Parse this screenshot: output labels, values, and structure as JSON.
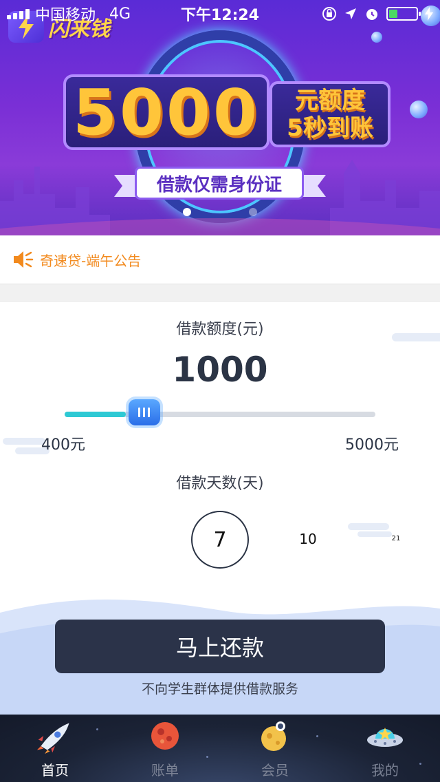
{
  "status_bar": {
    "carrier": "中国移动",
    "network": "4G",
    "time": "下午12:24",
    "battery_level": 0.25
  },
  "banner": {
    "app_name": "闪来钱",
    "headline_amount": "5000",
    "headline_line1": "元额度",
    "headline_line2": "5秒到账",
    "ribbon_text": "借款仅需身份证",
    "slide_count": 3,
    "active_slide": 0
  },
  "notice": {
    "text": "奇速贷-端午公告"
  },
  "loan": {
    "amount_label": "借款额度(元)",
    "amount_value": "1000",
    "slider_min_label": "400元",
    "slider_max_label": "5000元",
    "slider_min": 400,
    "slider_max": 5000,
    "slider_value": 1000,
    "days_label": "借款天数(天)",
    "day_options": [
      "7",
      "10",
      "21"
    ],
    "selected_day": "7"
  },
  "action": {
    "button_label": "马上还款",
    "disclaimer": "不向学生群体提供借款服务"
  },
  "tabbar": {
    "items": [
      {
        "label": "首页",
        "icon": "rocket-icon"
      },
      {
        "label": "账单",
        "icon": "planet-icon"
      },
      {
        "label": "会员",
        "icon": "astronaut-moon-icon"
      },
      {
        "label": "我的",
        "icon": "ufo-icon"
      }
    ],
    "active_index": 0
  },
  "colors": {
    "accent_dark": "#2b3349",
    "slider_fill": "#2ec9d4",
    "slider_thumb": "#2a6ee8",
    "notice_orange": "#f28a1e"
  }
}
